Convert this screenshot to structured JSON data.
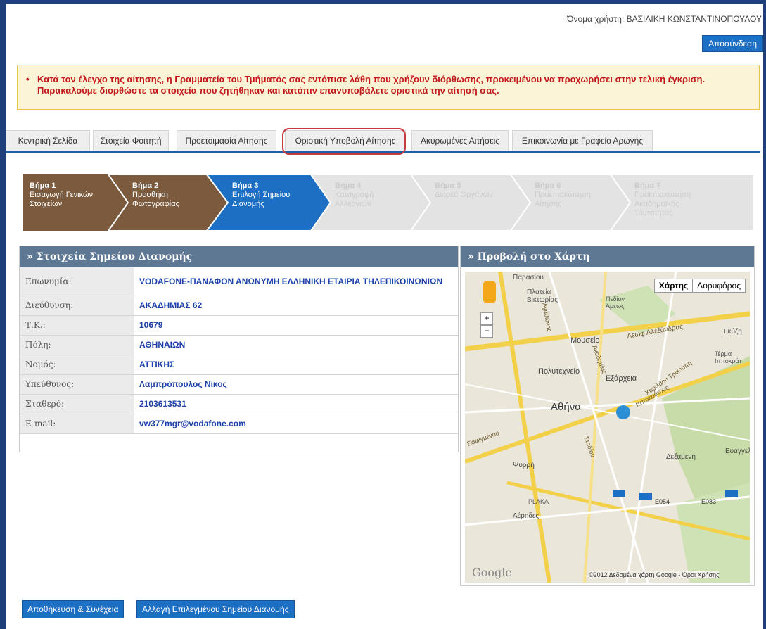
{
  "header": {
    "user_line": "Όνομα χρήστη: ΒΑΣΙΛΙΚΗ ΚΩΝΣΤΑΝΤΙΝΟΠΟΥΛΟΥ",
    "logout_label": "Αποσύνδεση"
  },
  "alert": {
    "line1": "Κατά τον έλεγχο της αίτησης, η Γραμματεία του Τμήματός σας εντόπισε λάθη που χρήζουν διόρθωσης, προκειμένου να προχωρήσει στην τελική έγκριση.",
    "line2": "Παρακαλούμε διορθώστε τα στοιχεία που ζητήθηκαν και κατόπιν επανυποβάλετε οριστικά την αίτησή σας."
  },
  "tabs": [
    {
      "label": "Κεντρική Σελίδα"
    },
    {
      "label": "Στοιχεία Φοιτητή"
    },
    {
      "label": "Προετοιμασία Αίτησης"
    },
    {
      "label": "Οριστική Υποβολή Αίτησης"
    },
    {
      "label": "Ακυρωμένες Αιτήσεις"
    },
    {
      "label": "Επικοινωνία με Γραφείο Αρωγής"
    }
  ],
  "steps": [
    {
      "title": "Βήμα 1",
      "desc": "Εισαγωγή Γενικών Στοιχείων",
      "state": "done"
    },
    {
      "title": "Βήμα 2",
      "desc": "Προσθήκη Φωτογραφίας",
      "state": "done"
    },
    {
      "title": "Βήμα 3",
      "desc": "Επιλογή Σημείου Διανομής",
      "state": "current"
    },
    {
      "title": "Βήμα 4",
      "desc": "Καταγραφή Αλλεργιών",
      "state": "disabled"
    },
    {
      "title": "Βήμα 5",
      "desc": "Δωρεά Οργάνων",
      "state": "disabled"
    },
    {
      "title": "Βήμα 6",
      "desc": "Προεπισκόπηση Αίτησης",
      "state": "disabled"
    },
    {
      "title": "Βήμα 7",
      "desc": "Προεπισκόπηση Ακαδημαϊκής Ταυτότητας",
      "state": "disabled"
    }
  ],
  "details": {
    "heading": "» Στοιχεία Σημείου Διανομής",
    "rows": [
      {
        "label": "Επωνυμία:",
        "value": "VODAFONE-ΠΑΝΑΦΟΝ ΑΝΩΝΥΜΗ ΕΛΛΗΝΙΚΗ ΕΤΑΙΡΙΑ ΤΗΛΕΠΙΚΟΙΝΩΝΙΩΝ"
      },
      {
        "label": "Διεύθυνση:",
        "value": "ΑΚΑΔΗΜΙΑΣ 62"
      },
      {
        "label": "Τ.Κ.:",
        "value": "10679"
      },
      {
        "label": "Πόλη:",
        "value": "ΑΘΗΝΑΙΩΝ"
      },
      {
        "label": "Νομός:",
        "value": "ΑΤΤΙΚΗΣ"
      },
      {
        "label": "Υπεύθυνος:",
        "value": "Λαμπρόπουλος Νίκος"
      },
      {
        "label": "Σταθερό:",
        "value": "2103613531"
      },
      {
        "label": "E-mail:",
        "value": "vw377mgr@vodafone.com"
      }
    ]
  },
  "map": {
    "heading": "» Προβολή στο Χάρτη",
    "toggle_map": "Χάρτης",
    "toggle_satellite": "Δορυφόρος",
    "zoom_in": "+",
    "zoom_out": "−",
    "labels": [
      "Παρασίου",
      "Πλατεία Βικτωρίας",
      "Πεδίον Άρεως",
      "Λεωφ Αλεξάνδρας",
      "Γκύζη",
      "Μουσείο",
      "Τέρμα Ιπποκράτ",
      "Πολυτεχνείο",
      "Εξάρχεια",
      "Αθήνα",
      "Ψυρρή",
      "Δεξαμενή",
      "Ευαγγελ",
      "PLAKA",
      "Αέρηδες",
      "Σταδίου",
      "Ακαδημίας",
      "Ιπποκράτους",
      "Χαριλάου Τρικούπη",
      "Αγαθώνος",
      "Εσφιγμένου"
    ],
    "road_badges": [
      "E054",
      "E083"
    ],
    "google_text": "Google",
    "attribution": "©2012 Δεδομένα χάρτη Google - Όροι Χρήσης"
  },
  "buttons": {
    "save_continue": "Αποθήκευση & Συνέχεια",
    "change_point": "Αλλαγή Επιλεγμένου Σημείου Διανομής"
  }
}
